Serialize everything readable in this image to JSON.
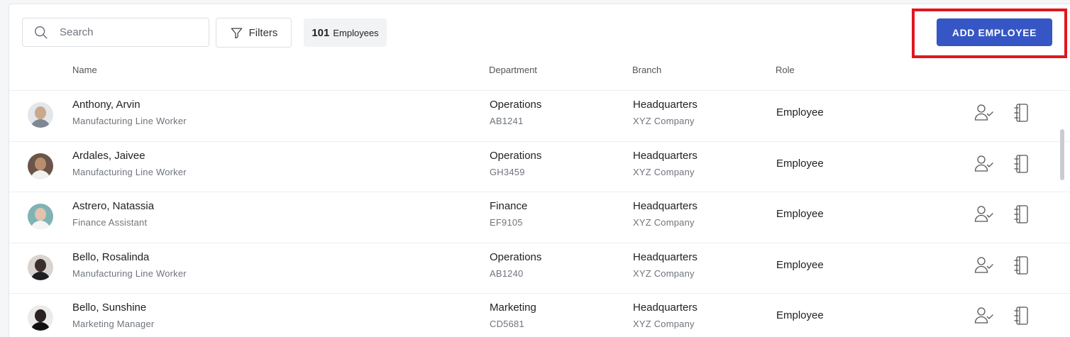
{
  "toolbar": {
    "search_placeholder": "Search",
    "filters_label": "Filters",
    "count_number": "101",
    "count_label": "Employees",
    "add_button_label": "ADD EMPLOYEE"
  },
  "columns": {
    "name": "Name",
    "department": "Department",
    "branch": "Branch",
    "role": "Role"
  },
  "employees": [
    {
      "name": "Anthony, Arvin",
      "title": "Manufacturing Line Worker",
      "department": "Operations",
      "code": "AB1241",
      "branch": "Headquarters",
      "company": "XYZ Company",
      "role": "Employee"
    },
    {
      "name": "Ardales, Jaivee",
      "title": "Manufacturing Line Worker",
      "department": "Operations",
      "code": "GH3459",
      "branch": "Headquarters",
      "company": "XYZ Company",
      "role": "Employee"
    },
    {
      "name": "Astrero, Natassia",
      "title": "Finance Assistant",
      "department": "Finance",
      "code": "EF9105",
      "branch": "Headquarters",
      "company": "XYZ Company",
      "role": "Employee"
    },
    {
      "name": "Bello, Rosalinda",
      "title": "Manufacturing Line Worker",
      "department": "Operations",
      "code": "AB1240",
      "branch": "Headquarters",
      "company": "XYZ Company",
      "role": "Employee"
    },
    {
      "name": "Bello, Sunshine",
      "title": "Marketing Manager",
      "department": "Marketing",
      "code": "CD5681",
      "branch": "Headquarters",
      "company": "XYZ Company",
      "role": "Employee"
    }
  ],
  "colors": {
    "accent": "#3556c4",
    "highlight": "#e0171f"
  },
  "icons": {
    "search": "search-icon",
    "filter": "filter-icon",
    "assign": "user-check-icon",
    "notebook": "notebook-icon"
  }
}
